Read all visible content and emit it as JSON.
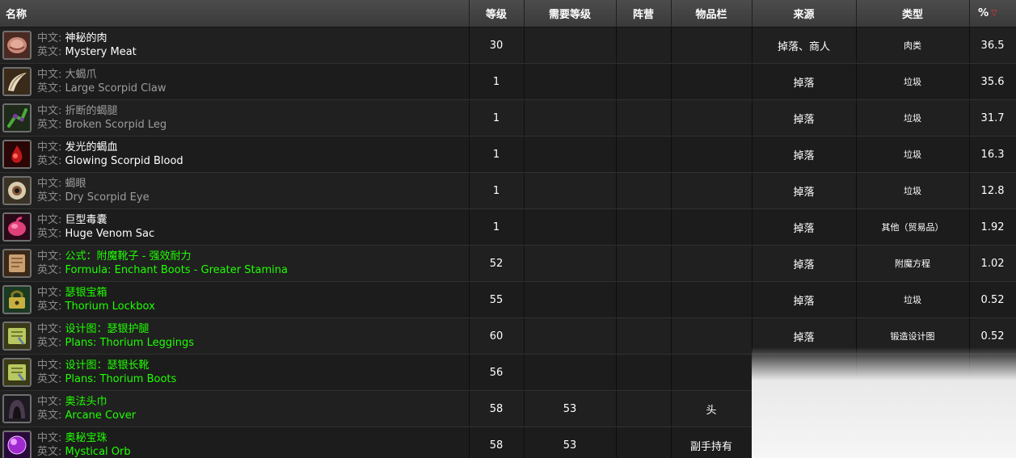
{
  "table": {
    "headers": {
      "name": "名称",
      "level": "等级",
      "req_level": "需要等级",
      "side": "阵营",
      "slot": "物品栏",
      "source": "来源",
      "type": "类型",
      "pct": "%"
    },
    "label_cn": "中文:",
    "label_en": "英文:",
    "rows": [
      {
        "icon": "meat-icon",
        "quality": "white",
        "cn": "神秘的肉",
        "en": "Mystery Meat",
        "level": "30",
        "req": "",
        "side": "",
        "slot": "",
        "source": "掉落、商人",
        "type": "肉类",
        "pct": "36.5"
      },
      {
        "icon": "claw-icon",
        "quality": "gray",
        "cn": "大蝎爪",
        "en": "Large Scorpid Claw",
        "level": "1",
        "req": "",
        "side": "",
        "slot": "",
        "source": "掉落",
        "type": "垃圾",
        "pct": "35.6"
      },
      {
        "icon": "scorpid-leg-icon",
        "quality": "gray",
        "cn": "折断的蝎腿",
        "en": "Broken Scorpid Leg",
        "level": "1",
        "req": "",
        "side": "",
        "slot": "",
        "source": "掉落",
        "type": "垃圾",
        "pct": "31.7"
      },
      {
        "icon": "blood-icon",
        "quality": "white",
        "cn": "发光的蝎血",
        "en": "Glowing Scorpid Blood",
        "level": "1",
        "req": "",
        "side": "",
        "slot": "",
        "source": "掉落",
        "type": "垃圾",
        "pct": "16.3"
      },
      {
        "icon": "eye-icon",
        "quality": "gray",
        "cn": "蝎眼",
        "en": "Dry Scorpid Eye",
        "level": "1",
        "req": "",
        "side": "",
        "slot": "",
        "source": "掉落",
        "type": "垃圾",
        "pct": "12.8"
      },
      {
        "icon": "venom-sac-icon",
        "quality": "white",
        "cn": "巨型毒囊",
        "en": "Huge Venom Sac",
        "level": "1",
        "req": "",
        "side": "",
        "slot": "",
        "source": "掉落",
        "type": "其他（贸易品）",
        "pct": "1.92"
      },
      {
        "icon": "scroll-icon",
        "quality": "green",
        "cn": "公式：附魔靴子 - 强效耐力",
        "en": "Formula: Enchant Boots - Greater Stamina",
        "level": "52",
        "req": "",
        "side": "",
        "slot": "",
        "source": "掉落",
        "type": "附魔方程",
        "pct": "1.02"
      },
      {
        "icon": "lockbox-icon",
        "quality": "green",
        "cn": "瑟银宝箱",
        "en": "Thorium Lockbox",
        "level": "55",
        "req": "",
        "side": "",
        "slot": "",
        "source": "掉落",
        "type": "垃圾",
        "pct": "0.52"
      },
      {
        "icon": "plans-icon",
        "quality": "green",
        "cn": "设计图：瑟银护腿",
        "en": "Plans: Thorium Leggings",
        "level": "60",
        "req": "",
        "side": "",
        "slot": "",
        "source": "掉落",
        "type": "锻造设计图",
        "pct": "0.52"
      },
      {
        "icon": "plans-icon",
        "quality": "green",
        "cn": "设计图：瑟银长靴",
        "en": "Plans: Thorium Boots",
        "level": "56",
        "req": "",
        "side": "",
        "slot": "",
        "source": "",
        "type": "",
        "pct": ""
      },
      {
        "icon": "hood-icon",
        "quality": "green",
        "cn": "奥法头巾",
        "en": "Arcane Cover",
        "level": "58",
        "req": "53",
        "side": "",
        "slot": "头",
        "source": "",
        "type": "",
        "pct": ""
      },
      {
        "icon": "orb-icon",
        "quality": "green",
        "cn": "奥秘宝珠",
        "en": "Mystical Orb",
        "level": "58",
        "req": "53",
        "side": "",
        "slot": "副手持有",
        "source": "",
        "type": "",
        "pct": ""
      }
    ]
  },
  "colors": {
    "quality_white": "#ffffff",
    "quality_gray": "#9d9d9d",
    "quality_green": "#1eff00",
    "sort_arrow": "#ff3030"
  }
}
